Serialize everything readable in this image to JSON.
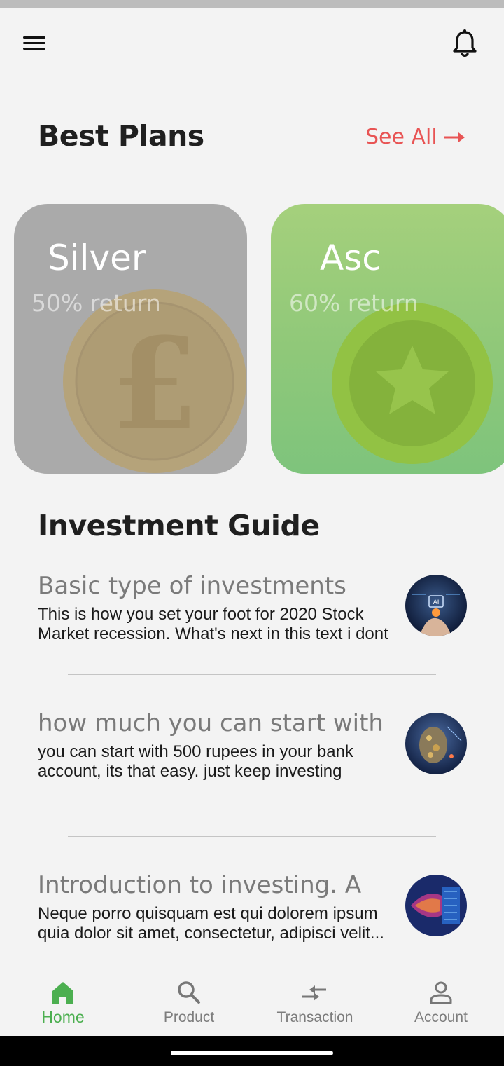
{
  "header": {
    "menu_icon": "hamburger-menu-icon",
    "notification_icon": "bell-icon"
  },
  "best_plans": {
    "title": "Best Plans",
    "see_all_label": "See All",
    "see_all_icon": "arrow-right-icon",
    "plans": [
      {
        "name": "Silver",
        "return_text": "50% return",
        "coin_icon": "pound-coin-icon",
        "card_color": "#aaaaaa"
      },
      {
        "name": "Asc",
        "return_text": "60% return",
        "coin_icon": "star-coin-icon",
        "card_color": "#8fc879"
      }
    ]
  },
  "investment_guide": {
    "title": "Investment Guide",
    "items": [
      {
        "heading": "Basic type of investments",
        "description": "This is how you set your foot for 2020 Stock Market recession. What's next in this text i dont",
        "thumbnail": "ai-hand-thumbnail"
      },
      {
        "heading": "how much you can start with",
        "description": "you can start with 500 rupees in your bank account, its that easy. just keep investing",
        "thumbnail": "robot-head-thumbnail"
      },
      {
        "heading": "Introduction to investing. A",
        "description": "Neque porro quisquam est qui dolorem ipsum quia dolor sit amet, consectetur, adipisci velit...",
        "thumbnail": "digital-face-thumbnail"
      }
    ]
  },
  "bottom_nav": {
    "active_color": "#4caf50",
    "items": [
      {
        "label": "Home",
        "icon": "home-icon",
        "active": true
      },
      {
        "label": "Product",
        "icon": "search-icon",
        "active": false
      },
      {
        "label": "Transaction",
        "icon": "transfer-arrows-icon",
        "active": false
      },
      {
        "label": "Account",
        "icon": "person-icon",
        "active": false
      }
    ]
  },
  "colors": {
    "accent_red": "#e85454",
    "background": "#f3f3f3"
  }
}
